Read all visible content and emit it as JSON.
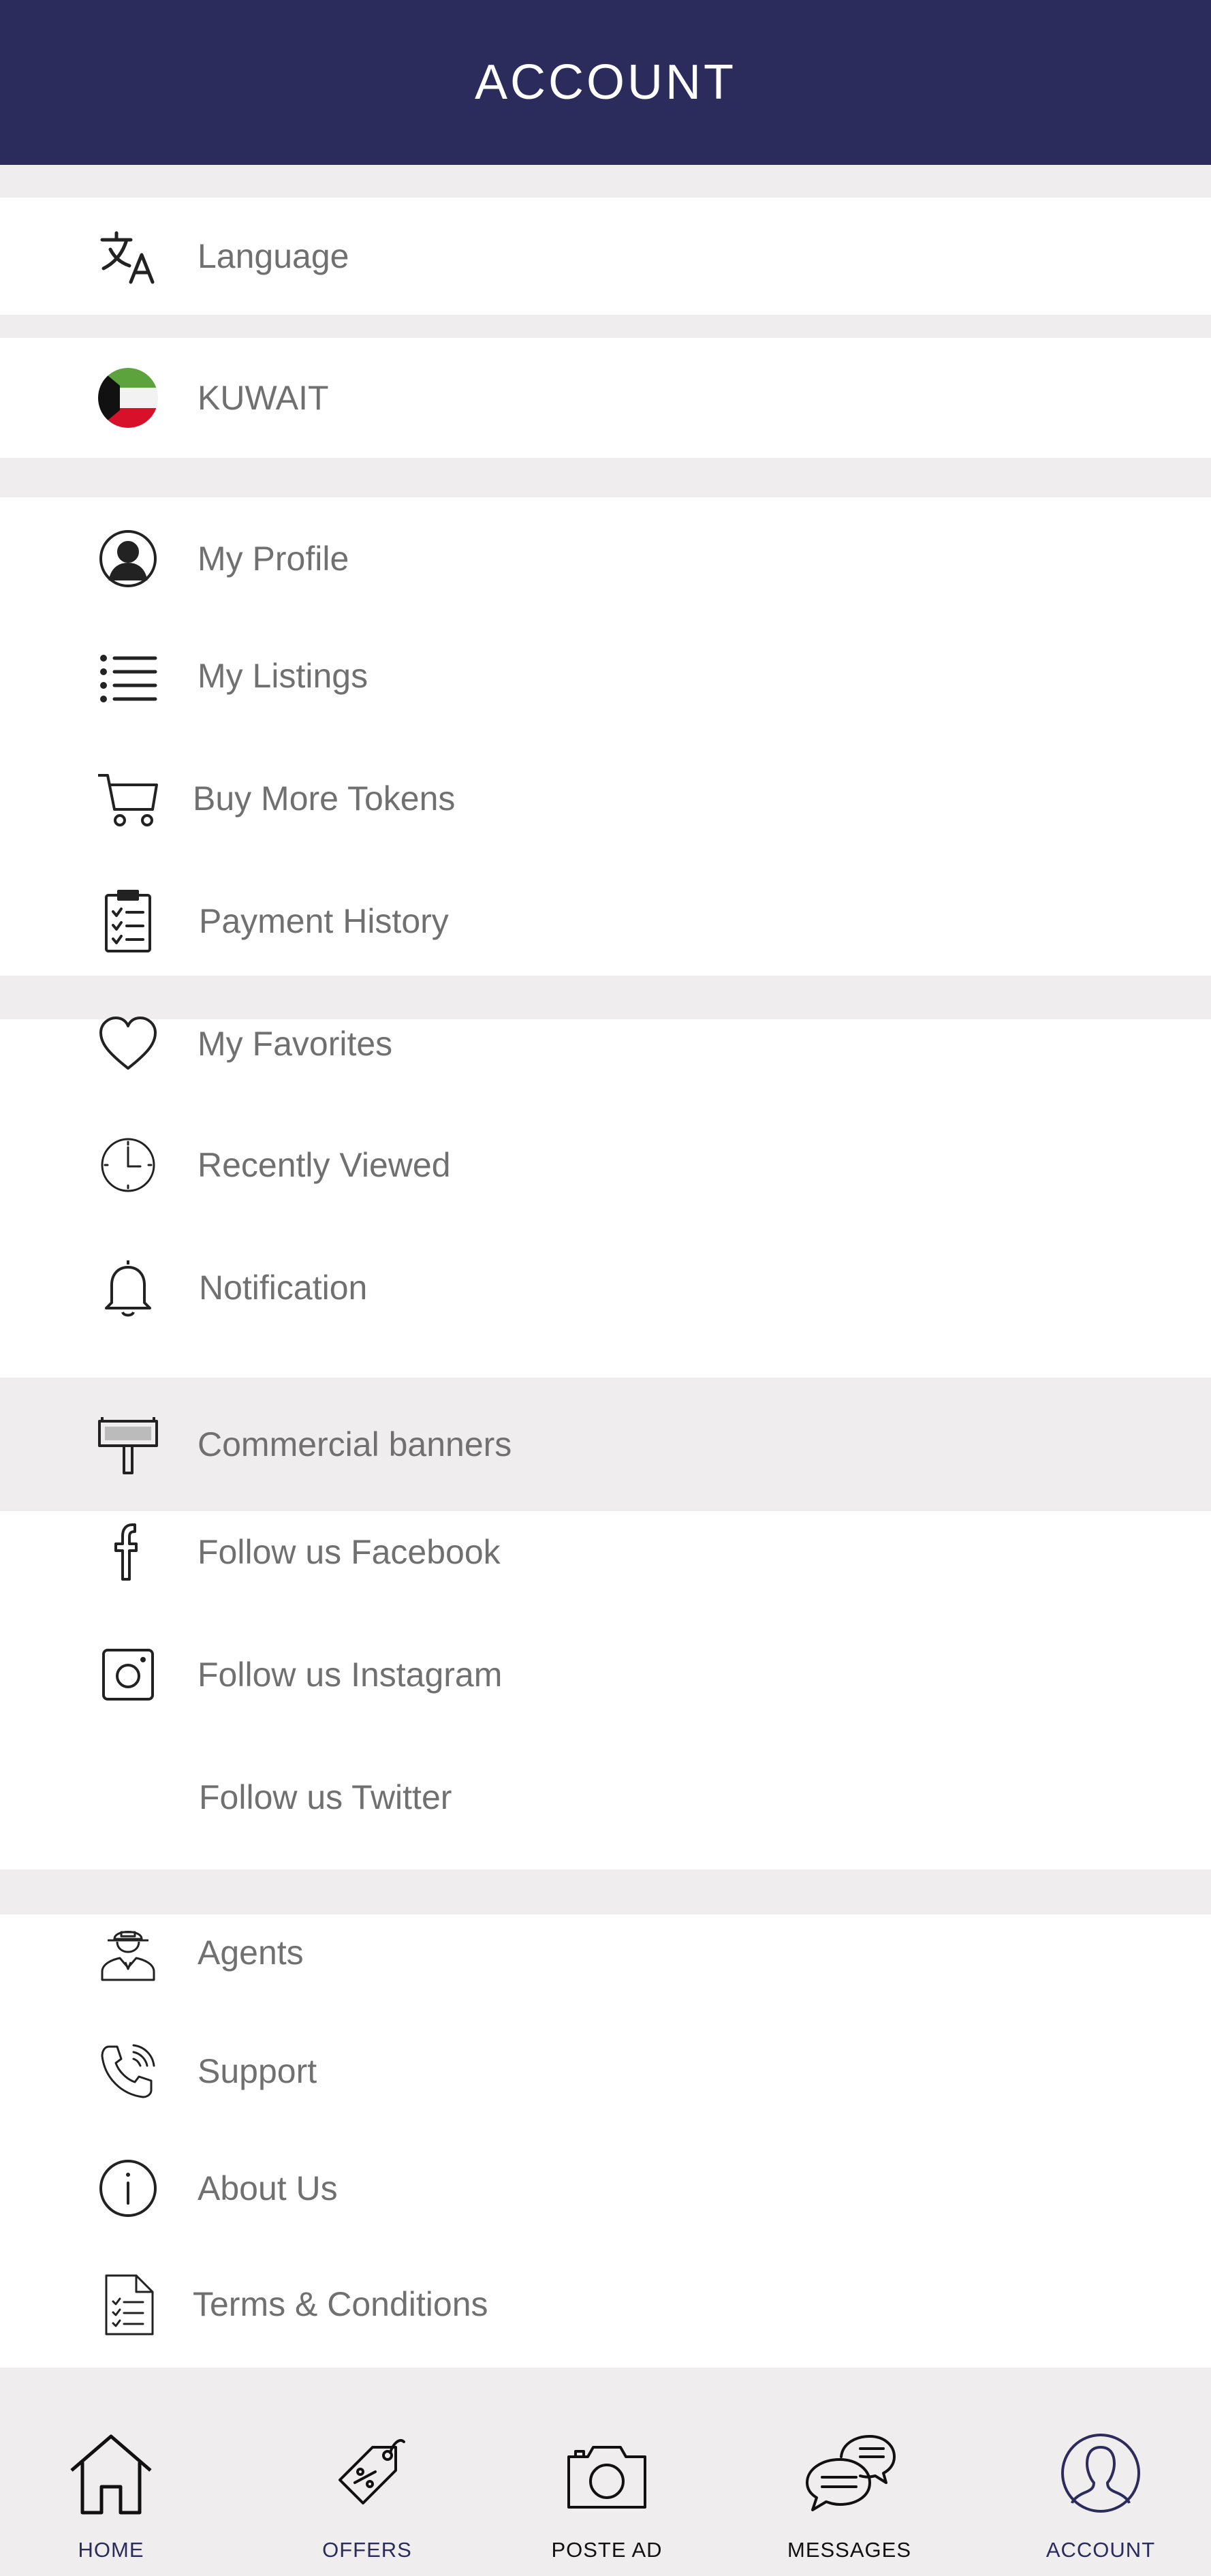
{
  "header": {
    "title": "ACCOUNT"
  },
  "settings": {
    "language": "Language",
    "country": "KUWAIT"
  },
  "account_menu": {
    "items": [
      {
        "label": "My Profile",
        "icon": "user-circle-icon"
      },
      {
        "label": "My Listings",
        "icon": "list-icon"
      },
      {
        "label": "Buy More Tokens",
        "icon": "cart-icon"
      },
      {
        "label": "Payment History",
        "icon": "clipboard-checklist-icon"
      }
    ]
  },
  "activity_menu": {
    "items": [
      {
        "label": "My Favorites",
        "icon": "heart-icon"
      },
      {
        "label": "Recently Viewed",
        "icon": "clock-icon"
      },
      {
        "label": "Notification",
        "icon": "bell-icon"
      }
    ]
  },
  "banner": {
    "label": "Commercial banners",
    "icon": "billboard-icon"
  },
  "social_menu": {
    "items": [
      {
        "label": "Follow us Facebook",
        "icon": "facebook-icon"
      },
      {
        "label": "Follow us Instagram",
        "icon": "instagram-icon"
      },
      {
        "label": "Follow us Twitter",
        "icon": ""
      }
    ]
  },
  "info_menu": {
    "items": [
      {
        "label": "Agents",
        "icon": "agent-icon"
      },
      {
        "label": "Support",
        "icon": "phone-icon"
      },
      {
        "label": "About Us",
        "icon": "info-icon"
      },
      {
        "label": "Terms & Conditions",
        "icon": "document-icon"
      }
    ]
  },
  "bottom_nav": {
    "items": [
      {
        "label": "HOME",
        "icon": "home-icon"
      },
      {
        "label": "OFFERS",
        "icon": "tag-icon"
      },
      {
        "label": "POSTE AD",
        "icon": "camera-icon"
      },
      {
        "label": "MESSAGES",
        "icon": "chat-icon"
      },
      {
        "label": "ACCOUNT",
        "icon": "account-icon"
      }
    ]
  },
  "colors": {
    "header_bg": "#2b2b5c",
    "text": "#707070",
    "divider_bg": "#efeded",
    "flag_green": "#5ca23d",
    "flag_red": "#d8112b"
  }
}
